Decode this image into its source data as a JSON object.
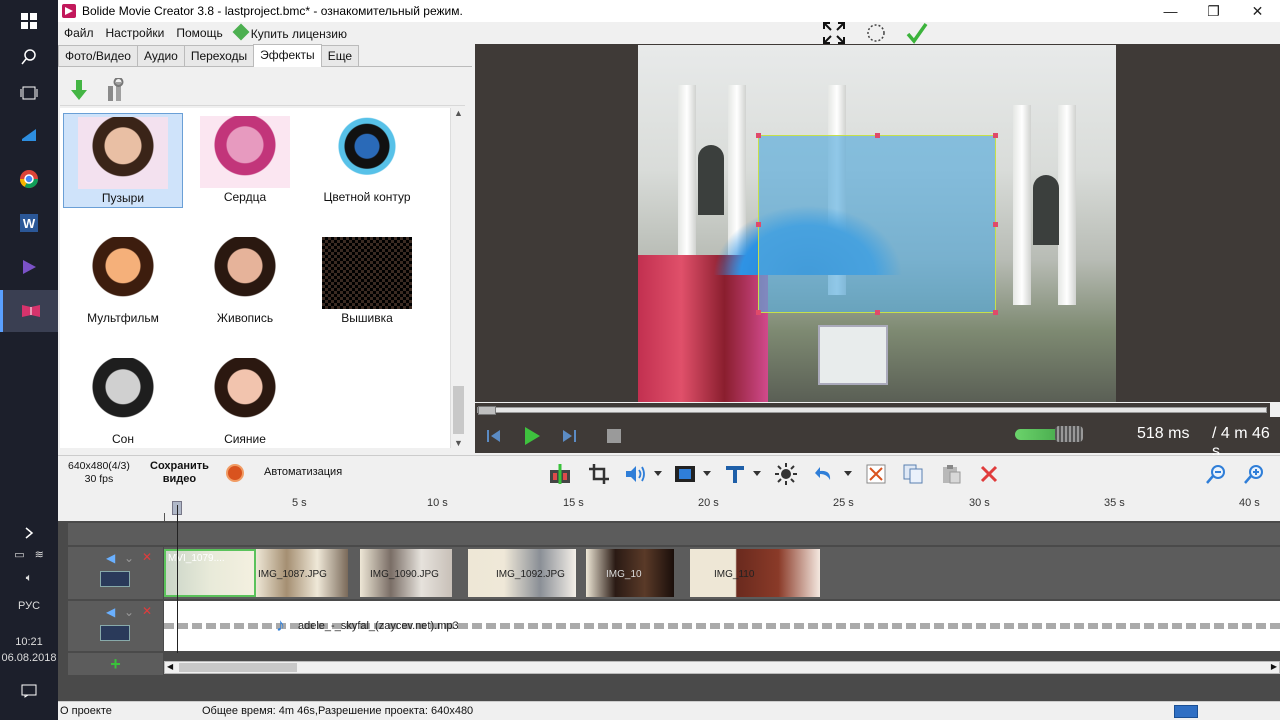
{
  "window": {
    "title": "Bolide Movie Creator 3.8 - lastproject.bmc* - ознакомительный режим.",
    "minimize": "—",
    "maximize": "❐",
    "close": "✕"
  },
  "taskbar": {
    "clock_time": "10:21",
    "clock_date": "06.08.2018",
    "language": "РУС",
    "icons": [
      "windows-icon",
      "search-icon",
      "task-view-icon",
      "store-icon",
      "chrome-icon",
      "word-icon",
      "media-player-icon",
      "bolide-icon"
    ]
  },
  "menu": {
    "file": "Файл",
    "settings": "Настройки",
    "help": "Помощь",
    "buy_license": "Купить лицензию"
  },
  "tabs": [
    {
      "label": "Фото/Видео",
      "active": false
    },
    {
      "label": "Аудио",
      "active": false
    },
    {
      "label": "Переходы",
      "active": false
    },
    {
      "label": "Эффекты",
      "active": true
    },
    {
      "label": "Еще",
      "active": false
    }
  ],
  "effects": [
    {
      "label": "Пузыри",
      "selected": true
    },
    {
      "label": "Сердца",
      "selected": false
    },
    {
      "label": "Цветной контур",
      "selected": false
    },
    {
      "label": "Мультфильм",
      "selected": false
    },
    {
      "label": "Живопись",
      "selected": false
    },
    {
      "label": "Вышивка",
      "selected": false
    },
    {
      "label": "Сон",
      "selected": false
    },
    {
      "label": "Сияние",
      "selected": false
    }
  ],
  "playback": {
    "current_time": "518 ms",
    "total_time": "/ 4 m 46 s",
    "volume_level": 0.6
  },
  "project": {
    "resolution": "640x480(4/3)",
    "fps": "30 fps",
    "save_line1": "Сохранить",
    "save_line2": "видео",
    "automation": "Автоматизация"
  },
  "ruler": {
    "labels": [
      "5 s",
      "10 s",
      "15 s",
      "20 s",
      "25 s",
      "30 s",
      "35 s",
      "40 s"
    ]
  },
  "clips": [
    {
      "label": "MVI_1079...."
    },
    {
      "label": "IMG_1087.JPG"
    },
    {
      "label": "IMG_1090.JPG"
    },
    {
      "label": "IMG_1092.JPG"
    },
    {
      "label": "IMG_10"
    },
    {
      "label": "IMG_110"
    }
  ],
  "audio": {
    "filename": "adele_-_skyfal_(zaycev.net).mp3"
  },
  "status": {
    "about": "О проекте",
    "total_time": "Общее время: 4m 46s,",
    "resolution": "Разрешение проекта:   640x480"
  },
  "colors": {
    "accent": "#1e5fa8",
    "selection": "#c6e04a",
    "preview_bg": "#3f3a37",
    "play_green": "#39c23a"
  }
}
